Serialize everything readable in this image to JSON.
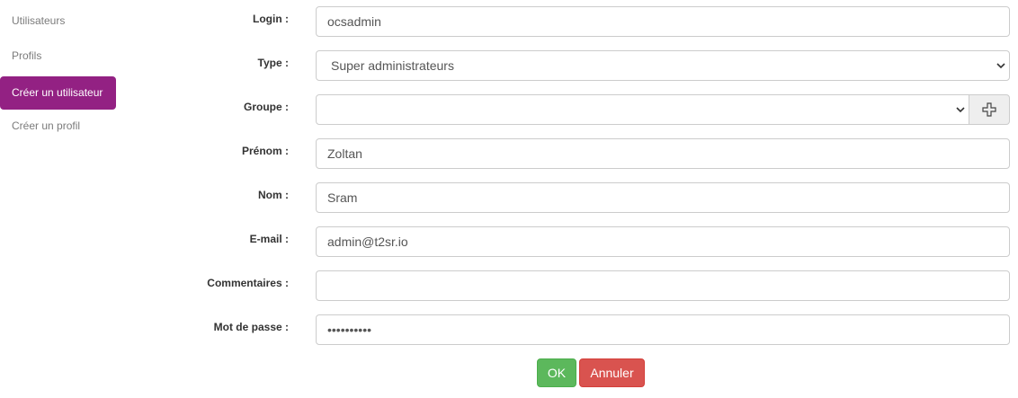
{
  "sidebar": {
    "items": [
      {
        "label": "Utilisateurs"
      },
      {
        "label": "Profils"
      },
      {
        "label": "Créer un utilisateur"
      },
      {
        "label": "Créer un profil"
      }
    ],
    "active_index": 2
  },
  "form": {
    "login": {
      "label": "Login :",
      "value": "ocsadmin"
    },
    "type": {
      "label": "Type :",
      "value": "Super administrateurs"
    },
    "groupe": {
      "label": "Groupe :",
      "value": "",
      "add_icon": "plus-outline-icon"
    },
    "prenom": {
      "label": "Prénom :",
      "value": "Zoltan"
    },
    "nom": {
      "label": "Nom :",
      "value": "Sram"
    },
    "email": {
      "label": "E-mail :",
      "value": "admin@t2sr.io"
    },
    "commentaires": {
      "label": "Commentaires :",
      "value": ""
    },
    "password": {
      "label": "Mot de passe :",
      "value": "••••••••••"
    }
  },
  "actions": {
    "ok_label": "OK",
    "cancel_label": "Annuler"
  },
  "colors": {
    "accent": "#932183",
    "ok": "#5cb85c",
    "cancel": "#d9534f"
  }
}
